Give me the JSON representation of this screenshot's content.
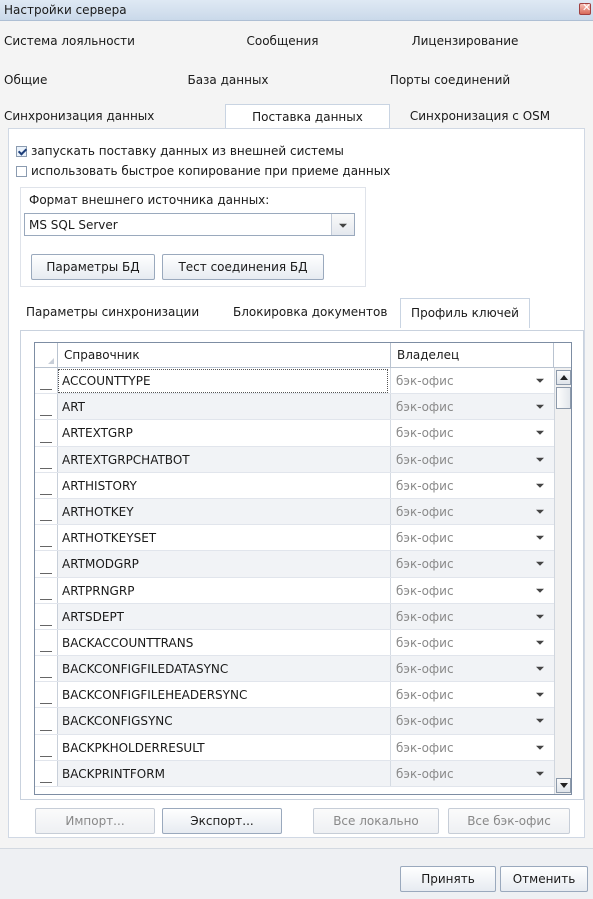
{
  "window": {
    "title": "Настройки сервера"
  },
  "tabs": {
    "row1": [
      "Система лояльности",
      "Сообщения",
      "Лицензирование"
    ],
    "row2": [
      "Общие",
      "База данных",
      "Порты соединений"
    ],
    "row3": [
      "Синхронизация данных",
      "Поставка данных",
      "Синхронизация с OSM"
    ],
    "active": "Поставка данных"
  },
  "options": {
    "external_supply": {
      "label": "запускать поставку данных из внешней системы",
      "checked": true
    },
    "fast_copy": {
      "label": "использовать быстрое копирование при приеме данных",
      "checked": false
    }
  },
  "source": {
    "format_label": "Формат внешнего источника данных:",
    "format_value": "MS SQL Server",
    "db_params_label": "Параметры БД",
    "db_test_label": "Тест соединения БД"
  },
  "subtabs": {
    "items": [
      "Параметры синхронизации",
      "Блокировка документов",
      "Профиль ключей"
    ],
    "active": "Профиль ключей"
  },
  "grid": {
    "col1_header": "Справочник",
    "col2_header": "Владелец",
    "rows": [
      {
        "name": "ACCOUNTTYPE",
        "owner": "бэк-офис"
      },
      {
        "name": "ART",
        "owner": "бэк-офис"
      },
      {
        "name": "ARTEXTGRP",
        "owner": "бэк-офис"
      },
      {
        "name": "ARTEXTGRPCHATBOT",
        "owner": "бэк-офис"
      },
      {
        "name": "ARTHISTORY",
        "owner": "бэк-офис"
      },
      {
        "name": "ARTHOTKEY",
        "owner": "бэк-офис"
      },
      {
        "name": "ARTHOTKEYSET",
        "owner": "бэк-офис"
      },
      {
        "name": "ARTMODGRP",
        "owner": "бэк-офис"
      },
      {
        "name": "ARTPRNGRP",
        "owner": "бэк-офис"
      },
      {
        "name": "ARTSDEPT",
        "owner": "бэк-офис"
      },
      {
        "name": "BACKACCOUNTTRANS",
        "owner": "бэк-офис"
      },
      {
        "name": "BACKCONFIGFILEDATASYNC",
        "owner": "бэк-офис"
      },
      {
        "name": "BACKCONFIGFILEHEADERSYNC",
        "owner": "бэк-офис"
      },
      {
        "name": "BACKCONFIGSYNC",
        "owner": "бэк-офис"
      },
      {
        "name": "BACKPKHOLDERRESULT",
        "owner": "бэк-офис"
      },
      {
        "name": "BACKPRINTFORM",
        "owner": "бэк-офис"
      }
    ]
  },
  "grid_actions": {
    "import": "Импорт...",
    "export": "Экспорт...",
    "all_local": "Все локально",
    "all_backoffice": "Все бэк-офис"
  },
  "footer": {
    "accept": "Принять",
    "cancel": "Отменить"
  }
}
